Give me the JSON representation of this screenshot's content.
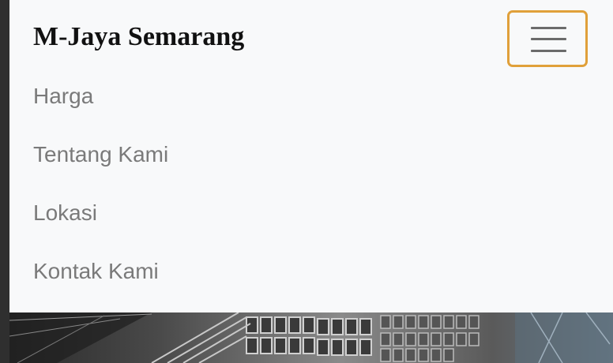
{
  "navbar": {
    "brand": "M-Jaya Semarang",
    "items": [
      {
        "label": "Harga"
      },
      {
        "label": "Tentang Kami"
      },
      {
        "label": "Lokasi"
      },
      {
        "label": "Kontak Kami"
      }
    ],
    "toggler_icon": "hamburger-menu-icon",
    "toggler_border_color": "#e0a03a"
  },
  "hero": {
    "image": "steel-warehouse-image"
  }
}
